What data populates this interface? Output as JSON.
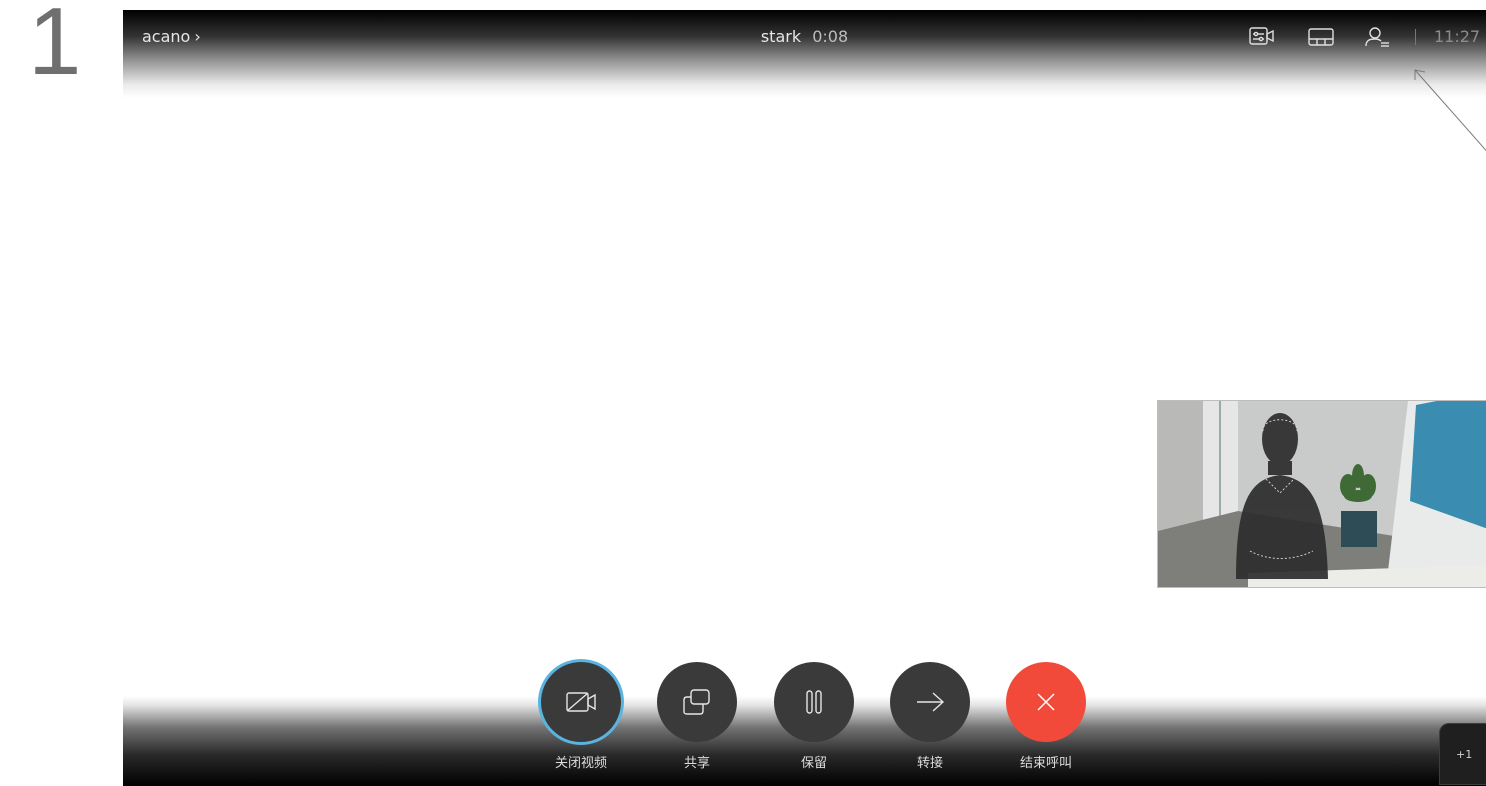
{
  "step_number": "1",
  "header": {
    "breadcrumb": "acano",
    "call_name": "stark",
    "call_duration": "0:08",
    "clock": "11:27",
    "icons": [
      "camera-controls-icon",
      "layout-icon",
      "participants-icon"
    ]
  },
  "controls": [
    {
      "label": "关闭视频",
      "icon": "camera-off-icon",
      "state": "active"
    },
    {
      "label": "共享",
      "icon": "share-icon"
    },
    {
      "label": "保留",
      "icon": "hold-icon"
    },
    {
      "label": "转接",
      "icon": "transfer-icon"
    },
    {
      "label": "结束呼叫",
      "icon": "end-call-icon",
      "color": "#f24a3a"
    }
  ],
  "more_tab": {
    "label": "+1"
  },
  "colors": {
    "accent": "#5ab4e0",
    "end_call": "#f24a3a",
    "button_bg": "#3a3a3a"
  }
}
